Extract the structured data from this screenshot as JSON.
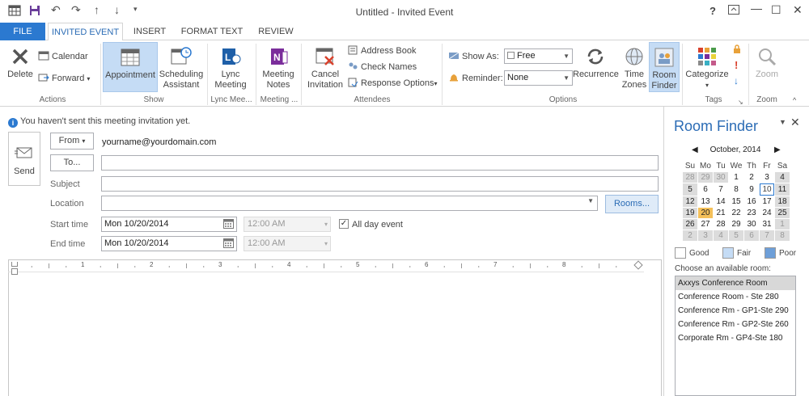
{
  "window": {
    "title": "Untitled - Invited Event",
    "help": "?",
    "minimize": "—",
    "maximize": "☐",
    "close": "✕"
  },
  "tabs": [
    {
      "label": "FILE"
    },
    {
      "label": "INVITED EVENT"
    },
    {
      "label": "INSERT"
    },
    {
      "label": "FORMAT TEXT"
    },
    {
      "label": "REVIEW"
    }
  ],
  "ribbon": {
    "actions": {
      "delete": "Delete",
      "calendar": "Calendar",
      "forward": "Forward",
      "label": "Actions"
    },
    "show": {
      "appointment": "Appointment",
      "scheduling1": "Scheduling",
      "scheduling2": "Assistant",
      "label": "Show"
    },
    "lync": {
      "l1": "Lync",
      "l2": "Meeting",
      "label": "Lync Mee..."
    },
    "notes": {
      "l1": "Meeting",
      "l2": "Notes",
      "label": "Meeting ..."
    },
    "attendees": {
      "cancel1": "Cancel",
      "cancel2": "Invitation",
      "address_book": "Address Book",
      "check_names": "Check Names",
      "response_options": "Response Options",
      "label": "Attendees"
    },
    "options": {
      "show_as": "Show As:",
      "show_as_value": "Free",
      "reminder": "Reminder:",
      "reminder_value": "None",
      "recurrence": "Recurrence",
      "tz1": "Time",
      "tz2": "Zones",
      "rf1": "Room",
      "rf2": "Finder",
      "label": "Options"
    },
    "tags": {
      "categorize": "Categorize",
      "label": "Tags"
    },
    "zoom": {
      "zoom": "Zoom",
      "label": "Zoom"
    }
  },
  "form": {
    "info": "You haven't sent this meeting invitation yet.",
    "send": "Send",
    "from_button": "From",
    "from_value": "yourname@yourdomain.com",
    "to_button": "To...",
    "subject": "Subject",
    "location": "Location",
    "rooms_button": "Rooms...",
    "start_time": "Start time",
    "end_time": "End time",
    "start_date": "Mon 10/20/2014",
    "end_date": "Mon 10/20/2014",
    "start_clock": "12:00 AM",
    "end_clock": "12:00 AM",
    "all_day": "All day event",
    "ruler_marks": [
      "1",
      "2",
      "3",
      "4",
      "5",
      "6",
      "7",
      "8"
    ]
  },
  "room_finder": {
    "title": "Room Finder",
    "month": "October, 2014",
    "weekdays": [
      "Su",
      "Mo",
      "Tu",
      "We",
      "Th",
      "Fr",
      "Sa"
    ],
    "weeks": [
      [
        "28",
        "29",
        "30",
        "1",
        "2",
        "3",
        "4"
      ],
      [
        "5",
        "6",
        "7",
        "8",
        "9",
        "10",
        "11"
      ],
      [
        "12",
        "13",
        "14",
        "15",
        "16",
        "17",
        "18"
      ],
      [
        "19",
        "20",
        "21",
        "22",
        "23",
        "24",
        "25"
      ],
      [
        "26",
        "27",
        "28",
        "29",
        "30",
        "31",
        "1"
      ],
      [
        "2",
        "3",
        "4",
        "5",
        "6",
        "7",
        "8"
      ]
    ],
    "legend_good": "Good",
    "legend_fair": "Fair",
    "legend_poor": "Poor",
    "choose": "Choose an available room:",
    "rooms": [
      "Axxys Conference Room",
      "Conference Room - Ste 280",
      "Conference Rm - GP1-Ste 290",
      "Conference Rm - GP2-Ste 260",
      "Corporate Rm - GP4-Ste 180"
    ]
  }
}
